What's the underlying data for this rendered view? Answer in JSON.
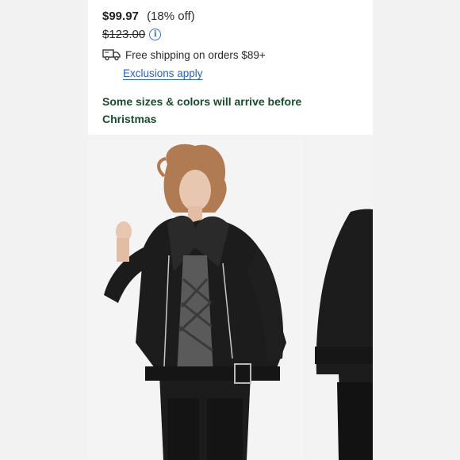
{
  "price": {
    "sale": "$99.97",
    "discount": "(18% off)",
    "original": "$123.00"
  },
  "shipping": {
    "text": "Free shipping on orders $89+",
    "link": "Exclusions apply"
  },
  "notice": "Some sizes & colors will arrive before Christmas",
  "colors": {
    "link": "#2b62b0",
    "notice": "#1c4a2e"
  },
  "icons": [
    "info-icon",
    "truck-icon"
  ]
}
